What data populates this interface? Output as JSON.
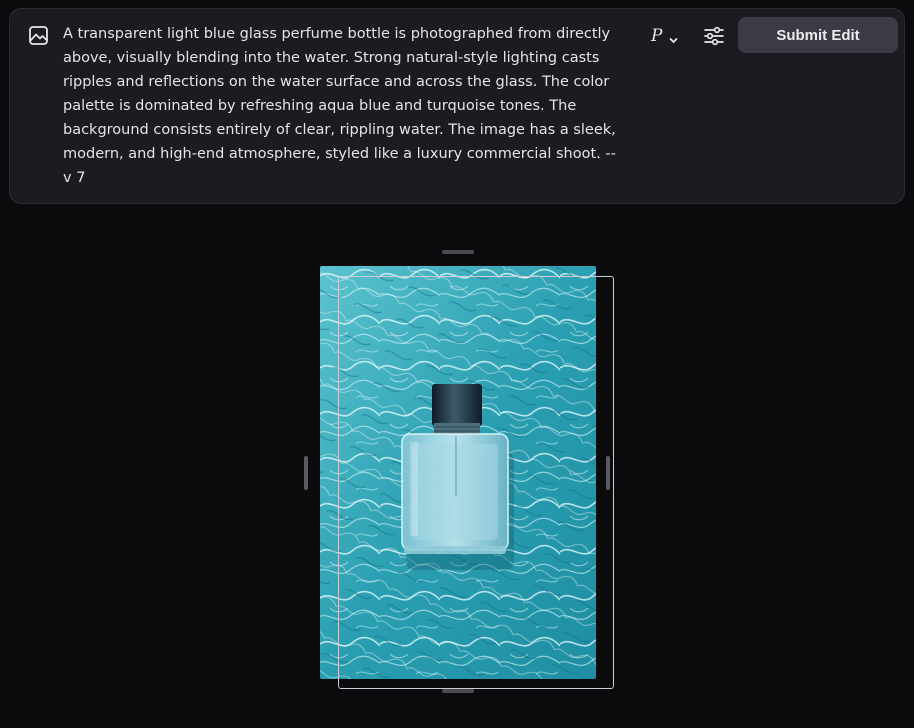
{
  "prompt": {
    "icon": "image-icon",
    "text": "A transparent light blue glass perfume bottle is photographed from directly above, visually blending into the water. Strong natural-style lighting casts ripples and reflections on the water surface and across the glass. The color palette is dominated by refreshing aqua blue and turquoise tones. The background consists entirely of clear, rippling water. The image has a sleek, modern, and high-end atmosphere, styled like a luxury commercial shoot. --v 7"
  },
  "toolbar": {
    "version_label": "P",
    "dropdown_icon": "chevron-down-icon",
    "settings_icon": "sliders-icon",
    "submit_label": "Submit Edit"
  },
  "canvas": {
    "image_subject": "perfume bottle on rippling water",
    "colors": {
      "water": "#2aa3b4",
      "highlight": "#e8fbff",
      "bottle_cap": "#1e3340"
    }
  }
}
